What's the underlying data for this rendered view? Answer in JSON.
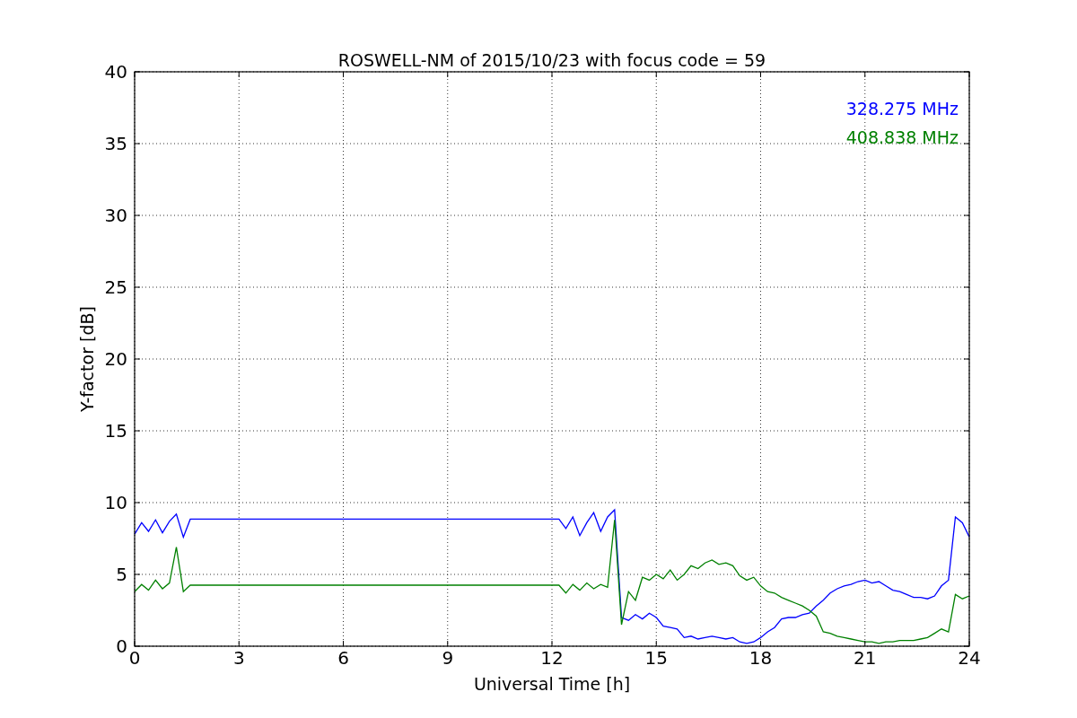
{
  "figure": {
    "chart_data": {
      "type": "line",
      "title": "ROSWELL-NM of 2015/10/23 with focus code = 59",
      "xlabel": "Universal Time [h]",
      "ylabel": "Y-factor [dB]",
      "grid": true,
      "xlim": [
        0,
        24
      ],
      "ylim": [
        0,
        40
      ],
      "xticks": [
        0,
        3,
        6,
        9,
        12,
        15,
        18,
        21,
        24
      ],
      "yticks": [
        0,
        5,
        10,
        15,
        20,
        25,
        30,
        35,
        40
      ],
      "x": [
        0,
        0.2,
        0.4,
        0.6,
        0.8,
        1.0,
        1.2,
        1.4,
        1.6,
        12.2,
        12.4,
        12.6,
        12.8,
        13.0,
        13.2,
        13.4,
        13.6,
        13.8,
        14.0,
        14.2,
        14.4,
        14.6,
        14.8,
        15.0,
        15.2,
        15.4,
        15.6,
        15.8,
        16.0,
        16.2,
        16.4,
        16.6,
        16.8,
        17.0,
        17.2,
        17.4,
        17.6,
        17.8,
        18.0,
        18.2,
        18.4,
        18.6,
        18.8,
        19.0,
        19.2,
        19.4,
        19.6,
        19.8,
        20.0,
        20.2,
        20.4,
        20.6,
        20.8,
        21.0,
        21.2,
        21.4,
        21.6,
        21.8,
        22.0,
        22.2,
        22.4,
        22.6,
        22.8,
        23.0,
        23.2,
        23.4,
        23.6,
        23.8,
        24.0
      ],
      "series": [
        {
          "name": "328.275 MHz",
          "color": "#0000ff",
          "values": [
            7.8,
            8.6,
            8.0,
            8.8,
            7.9,
            8.7,
            9.2,
            7.6,
            8.85,
            8.85,
            8.2,
            9.0,
            7.7,
            8.6,
            9.3,
            8.0,
            9.0,
            9.5,
            2.0,
            1.8,
            2.2,
            1.9,
            2.3,
            2.0,
            1.4,
            1.3,
            1.2,
            0.6,
            0.7,
            0.5,
            0.6,
            0.7,
            0.6,
            0.5,
            0.6,
            0.3,
            0.2,
            0.3,
            0.6,
            1.0,
            1.3,
            1.9,
            2.0,
            2.0,
            2.2,
            2.3,
            2.8,
            3.2,
            3.7,
            4.0,
            4.2,
            4.3,
            4.5,
            4.6,
            4.4,
            4.5,
            4.2,
            3.9,
            3.8,
            3.6,
            3.4,
            3.4,
            3.3,
            3.5,
            4.2,
            4.6,
            9.0,
            8.6,
            7.6
          ]
        },
        {
          "name": "408.838 MHz",
          "color": "#008000",
          "values": [
            3.8,
            4.3,
            3.9,
            4.6,
            4.0,
            4.4,
            6.9,
            3.8,
            4.25,
            4.25,
            3.7,
            4.3,
            3.9,
            4.4,
            4.0,
            4.3,
            4.1,
            8.8,
            1.5,
            3.8,
            3.2,
            4.8,
            4.6,
            5.0,
            4.7,
            5.3,
            4.6,
            5.0,
            5.6,
            5.4,
            5.8,
            6.0,
            5.7,
            5.8,
            5.6,
            4.9,
            4.6,
            4.8,
            4.2,
            3.8,
            3.7,
            3.4,
            3.2,
            3.0,
            2.8,
            2.5,
            2.1,
            1.0,
            0.9,
            0.7,
            0.6,
            0.5,
            0.4,
            0.3,
            0.3,
            0.2,
            0.3,
            0.3,
            0.4,
            0.4,
            0.4,
            0.5,
            0.6,
            0.9,
            1.2,
            1.0,
            3.6,
            3.3,
            3.5
          ]
        }
      ]
    }
  }
}
